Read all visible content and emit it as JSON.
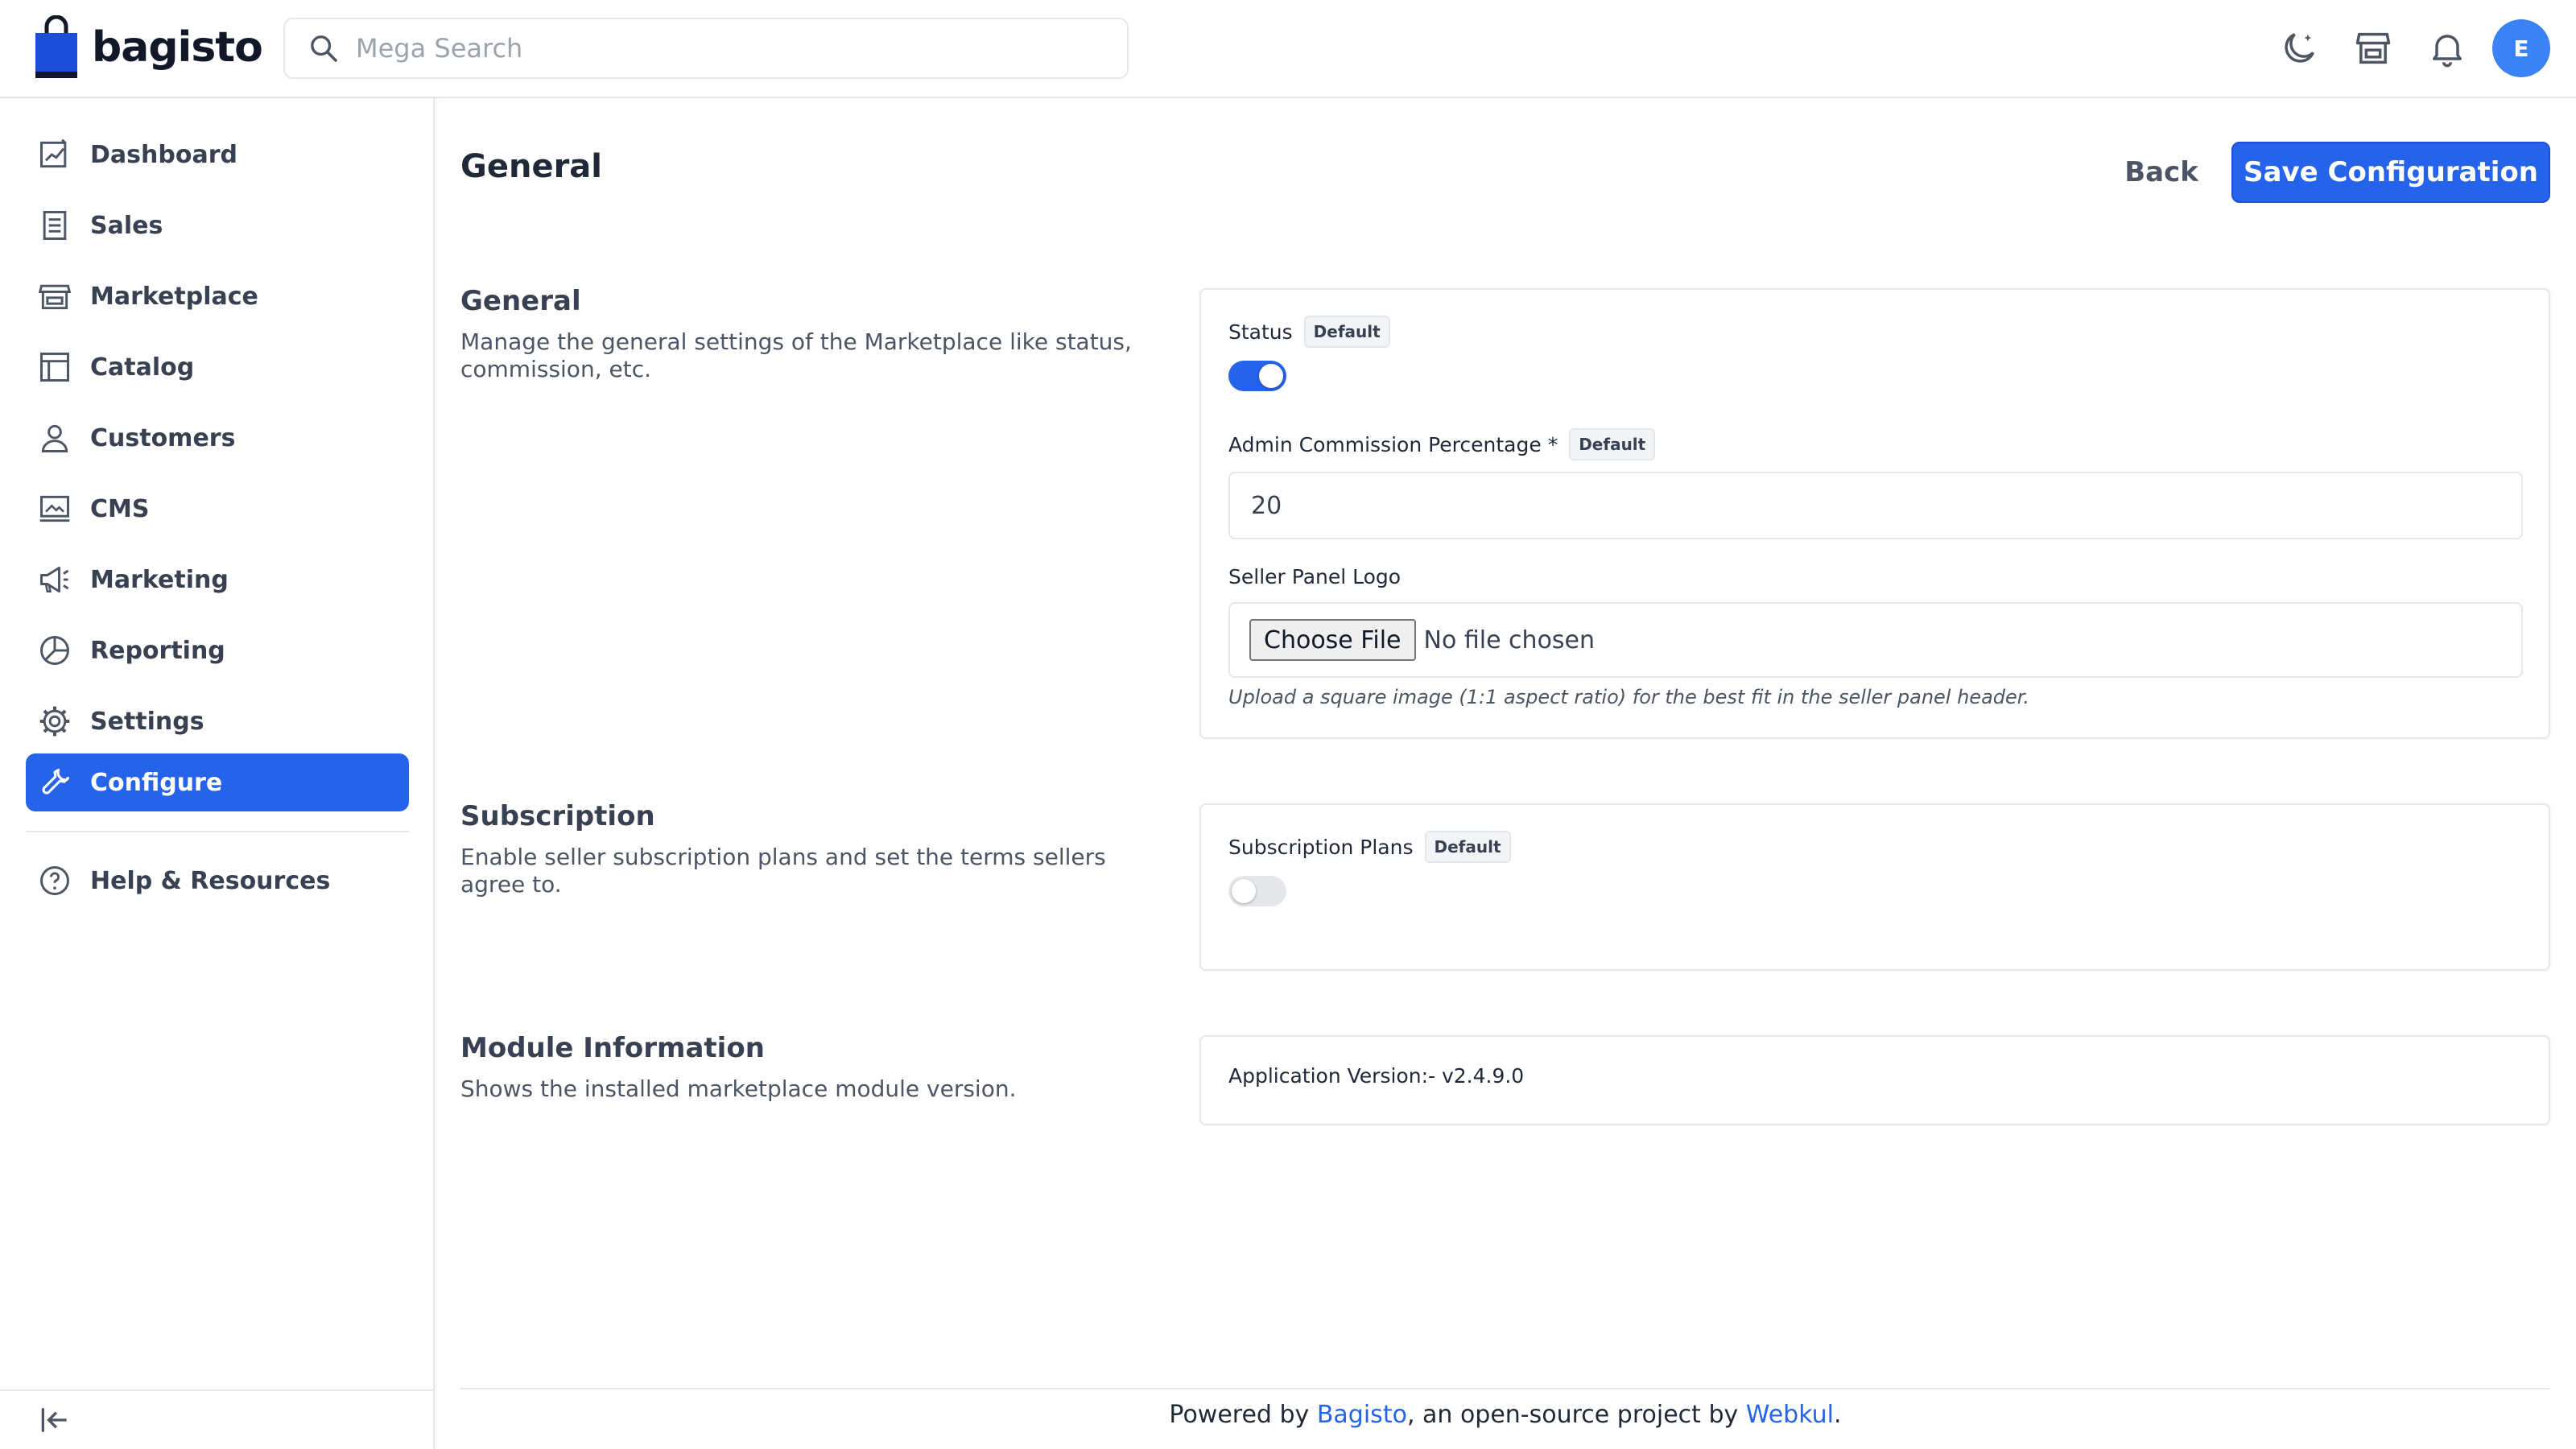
{
  "header": {
    "brand": "bagisto",
    "search_placeholder": "Mega Search",
    "avatar_initial": "E"
  },
  "sidebar": {
    "items": [
      {
        "label": "Dashboard",
        "icon": "dashboard-icon"
      },
      {
        "label": "Sales",
        "icon": "sales-icon"
      },
      {
        "label": "Marketplace",
        "icon": "store-icon"
      },
      {
        "label": "Catalog",
        "icon": "catalog-icon"
      },
      {
        "label": "Customers",
        "icon": "user-icon"
      },
      {
        "label": "CMS",
        "icon": "cms-icon"
      },
      {
        "label": "Marketing",
        "icon": "megaphone-icon"
      },
      {
        "label": "Reporting",
        "icon": "pie-chart-icon"
      },
      {
        "label": "Settings",
        "icon": "gear-icon"
      },
      {
        "label": "Configure",
        "icon": "wrench-icon",
        "active": true
      }
    ],
    "help_label": "Help & Resources"
  },
  "page": {
    "title": "General",
    "back_label": "Back",
    "save_label": "Save Configuration"
  },
  "sections": {
    "general": {
      "title": "General",
      "description": "Manage the general settings of the Marketplace like status, commission, etc.",
      "status_label": "Status",
      "status_badge": "Default",
      "status_on": true,
      "commission_label": "Admin Commission Percentage *",
      "commission_badge": "Default",
      "commission_value": "20",
      "logo_label": "Seller Panel Logo",
      "choose_file_label": "Choose File",
      "no_file_label": "No file chosen",
      "logo_hint": "Upload a square image (1:1 aspect ratio) for the best fit in the seller panel header."
    },
    "subscription": {
      "title": "Subscription",
      "description": "Enable seller subscription plans and set the terms sellers agree to.",
      "plans_label": "Subscription Plans",
      "plans_badge": "Default",
      "plans_on": false
    },
    "module": {
      "title": "Module Information",
      "description": "Shows the installed marketplace module version.",
      "version_text": "Application Version:- v2.4.9.0"
    }
  },
  "footer": {
    "prefix": "Powered by ",
    "bagisto_link": "Bagisto",
    "middle": ", an open-source project by ",
    "webkul_link": "Webkul",
    "suffix": "."
  },
  "colors": {
    "primary": "#2563eb",
    "avatar": "#3b82f6"
  }
}
